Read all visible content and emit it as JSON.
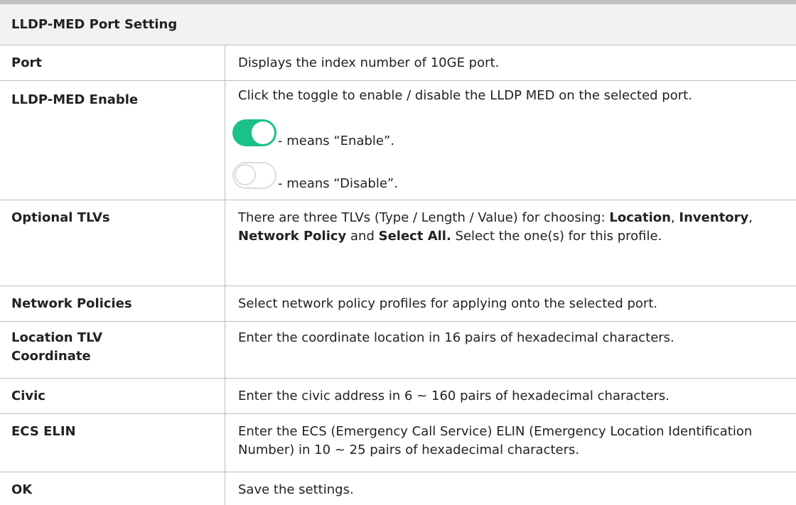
{
  "header": "LLDP-MED Port Setting",
  "rows": [
    {
      "label": "Port",
      "desc": "Displays the index number of 10GE port."
    },
    {
      "label": "LLDP-MED Enable",
      "desc": "Click the toggle to enable / disable the LLDP MED on the selected port.",
      "enable_text": "- means “Enable”.",
      "disable_text": "- means “Disable”."
    },
    {
      "label": "Optional TLVs",
      "desc_parts": [
        "There are three TLVs (Type / Length / Value) for choosing: ",
        "Location",
        ", ",
        "Inventory",
        ", ",
        "Network Policy",
        " and ",
        "Select All.",
        " Select the one(s) for this profile."
      ]
    },
    {
      "label": "Network Policies",
      "desc": "Select network policy profiles for applying onto the selected port."
    },
    {
      "label_line1": "Location TLV",
      "label_line2": "Coordinate",
      "desc": "Enter the coordinate location in 16 pairs of hexadecimal characters."
    },
    {
      "label": "Civic",
      "desc": "Enter the civic address in 6 ~ 160 pairs of hexadecimal characters."
    },
    {
      "label": "ECS ELIN",
      "desc": "Enter the ECS (Emergency Call Service) ELIN (Emergency Location Identification Number) in 10 ~ 25 pairs of hexadecimal characters."
    },
    {
      "label": "OK",
      "desc": "Save the settings."
    }
  ],
  "colors": {
    "toggle_on": "#1cc08a",
    "toggle_off_border": "#dcdcdc",
    "header_bg": "#f2f2f2",
    "rule": "#bdbdbd"
  },
  "icons": [
    "toggle-on-icon",
    "toggle-off-icon"
  ]
}
